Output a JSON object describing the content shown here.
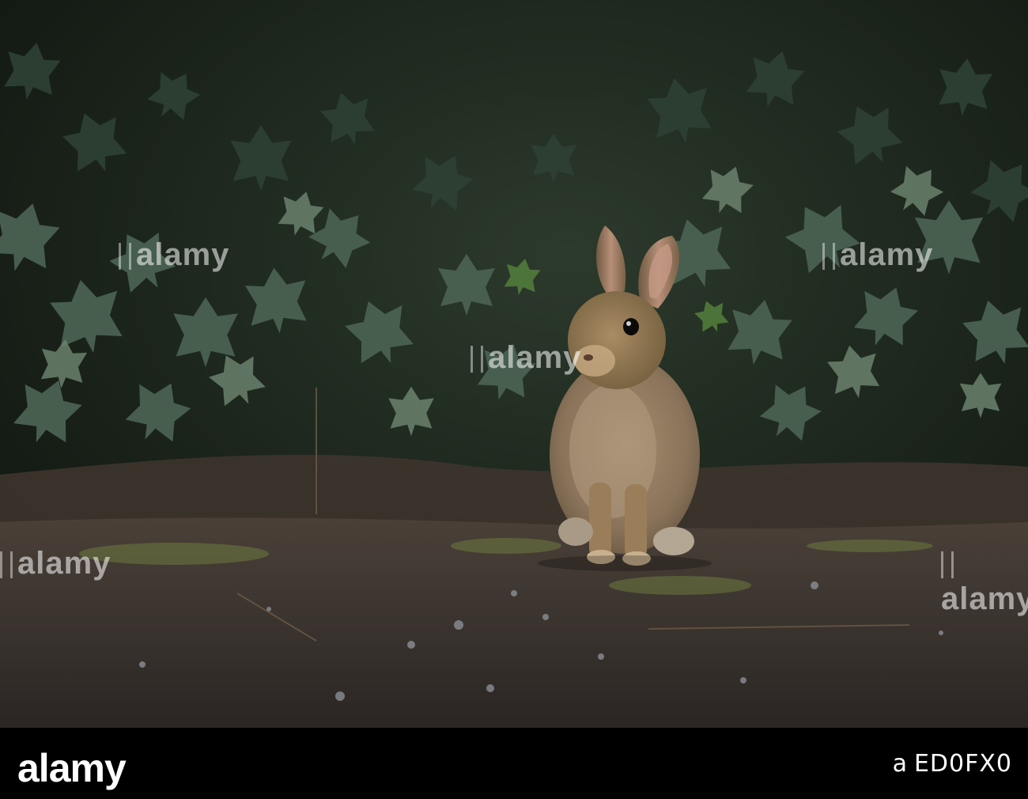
{
  "photo": {
    "subject": "rabbit",
    "colors": {
      "foliage_dark": "#18201a",
      "ivy": "#3e5446",
      "ivy_light": "#6f8873",
      "ground": "#3b3530",
      "moss": "#6d7a3e",
      "fur": "#8b7355",
      "fur_light": "#c9ad85"
    }
  },
  "watermark": {
    "text": "alamy"
  },
  "footer": {
    "brand": "alamy",
    "ref_label": "a",
    "image_id": "ED0FX0"
  }
}
